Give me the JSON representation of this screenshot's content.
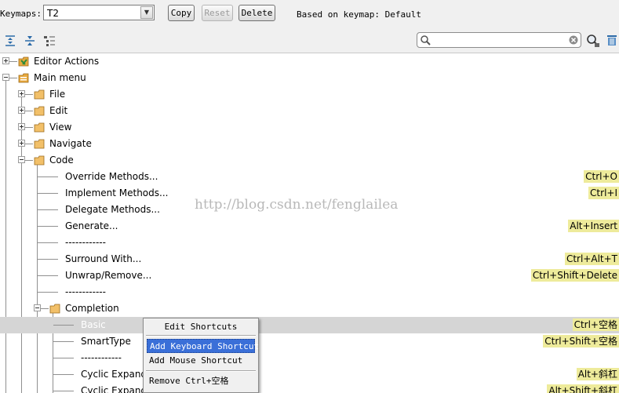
{
  "keymap_bar": {
    "label": "Keymaps:",
    "selected_keymap": "T2",
    "copy_label": "Copy",
    "reset_label": "Reset",
    "delete_label": "Delete",
    "based_on": "Based on keymap: Default"
  },
  "toolbar": {
    "search_value": "",
    "icons": [
      "expand-all-icon",
      "collapse-all-icon",
      "tree-options-icon",
      "search-icon",
      "clear-icon",
      "find-by-shortcut-icon",
      "trash-icon"
    ]
  },
  "tree": {
    "rows": [
      {
        "label": "Editor Actions"
      },
      {
        "label": "Main menu"
      },
      {
        "label": "File"
      },
      {
        "label": "Edit"
      },
      {
        "label": "View"
      },
      {
        "label": "Navigate"
      },
      {
        "label": "Code"
      },
      {
        "label": "Override Methods...",
        "shortcut": "Ctrl+O"
      },
      {
        "label": "Implement Methods...",
        "shortcut": "Ctrl+I"
      },
      {
        "label": "Delegate Methods..."
      },
      {
        "label": "Generate...",
        "shortcut": "Alt+Insert"
      },
      {
        "label": "------------"
      },
      {
        "label": "Surround With...",
        "shortcut": "Ctrl+Alt+T"
      },
      {
        "label": "Unwrap/Remove...",
        "shortcut": "Ctrl+Shift+Delete"
      },
      {
        "label": "------------"
      },
      {
        "label": "Completion"
      },
      {
        "label": "Basic",
        "shortcut": "Ctrl+空格"
      },
      {
        "label": "SmartType",
        "shortcut": "Ctrl+Shift+空格"
      },
      {
        "label": "------------"
      },
      {
        "label": "Cyclic Expand",
        "shortcut": "Alt+斜杠"
      },
      {
        "label": "Cyclic Expand",
        "shortcut": "Alt+Shift+斜杠"
      }
    ]
  },
  "watermark": "http://blog.csdn.net/fenglailea",
  "context_menu": {
    "title": "Edit Shortcuts",
    "items": [
      {
        "label": "Add Keyboard Shortcut"
      },
      {
        "label": "Add Mouse Shortcut"
      },
      {
        "label": "Remove Ctrl+空格"
      }
    ]
  },
  "colors": {
    "shortcut_highlight": "#eeeb9b",
    "selected_row": "#d5d5d5",
    "menu_active": "#3a6fd8",
    "folder": "#e8a93d"
  }
}
